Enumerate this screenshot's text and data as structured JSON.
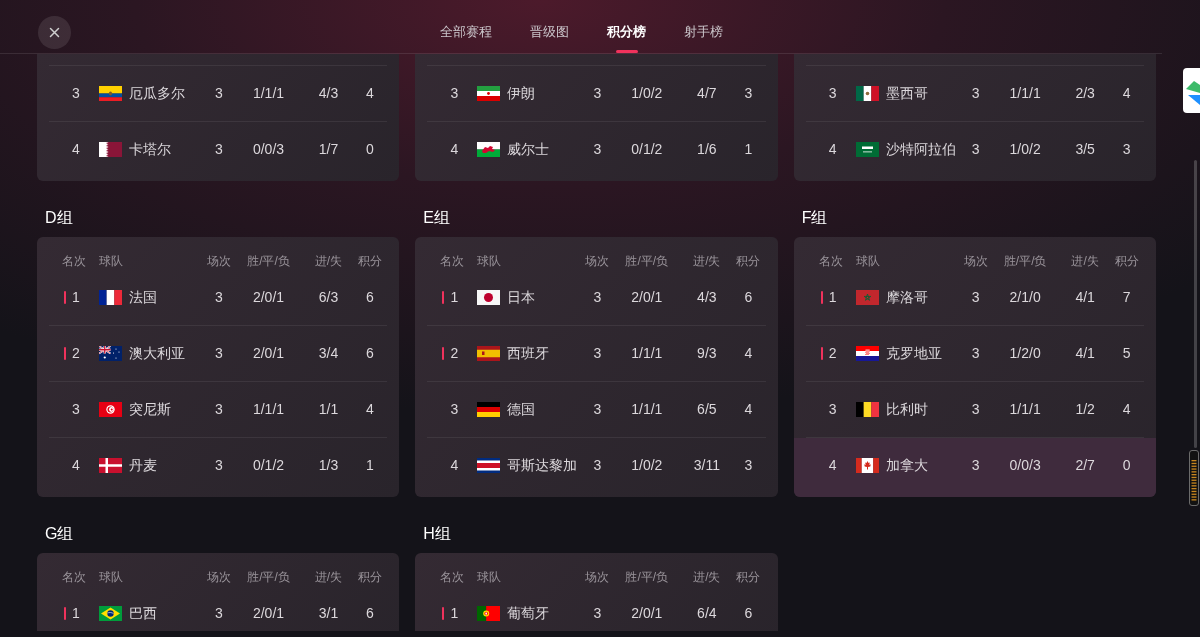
{
  "tabs": [
    {
      "label": "全部赛程",
      "selected": false
    },
    {
      "label": "晋级图",
      "selected": false
    },
    {
      "label": "积分榜",
      "selected": true
    },
    {
      "label": "射手榜",
      "selected": false
    }
  ],
  "groups": [
    {
      "rows": [
        {
          "rank": "3",
          "flag": {
            "kind": "ec"
          },
          "team": "厄瓜多尔",
          "played": "3",
          "win_draw_loss": "1/1/1",
          "goals": "4/3",
          "points": "4",
          "qualified": false,
          "highlighted": false
        },
        {
          "rank": "4",
          "flag": {
            "kind": "qa"
          },
          "team": "卡塔尔",
          "played": "3",
          "win_draw_loss": "0/0/3",
          "goals": "1/7",
          "points": "0",
          "qualified": false,
          "highlighted": false
        }
      ]
    },
    {
      "rows": [
        {
          "rank": "3",
          "flag": {
            "kind": "ir"
          },
          "team": "伊朗",
          "played": "3",
          "win_draw_loss": "1/0/2",
          "goals": "4/7",
          "points": "3",
          "qualified": false,
          "highlighted": false
        },
        {
          "rank": "4",
          "flag": {
            "kind": "wal"
          },
          "team": "威尔士",
          "played": "3",
          "win_draw_loss": "0/1/2",
          "goals": "1/6",
          "points": "1",
          "qualified": false,
          "highlighted": false
        }
      ]
    },
    {
      "rows": [
        {
          "rank": "3",
          "flag": {
            "kind": "mx"
          },
          "team": "墨西哥",
          "played": "3",
          "win_draw_loss": "1/1/1",
          "goals": "2/3",
          "points": "4",
          "qualified": false,
          "highlighted": false
        },
        {
          "rank": "4",
          "flag": {
            "kind": "sa"
          },
          "team": "沙特阿拉伯",
          "played": "3",
          "win_draw_loss": "1/0/2",
          "goals": "3/5",
          "points": "3",
          "qualified": false,
          "highlighted": false
        }
      ]
    },
    {
      "title": "D组",
      "columns": [
        "名次",
        "球队",
        "场次",
        "胜/平/负",
        "进/失",
        "积分"
      ],
      "rows": [
        {
          "rank": "1",
          "flag": {
            "kind": "fr"
          },
          "team": "法国",
          "played": "3",
          "win_draw_loss": "2/0/1",
          "goals": "6/3",
          "points": "6",
          "qualified": true,
          "highlighted": false
        },
        {
          "rank": "2",
          "flag": {
            "kind": "au"
          },
          "team": "澳大利亚",
          "played": "3",
          "win_draw_loss": "2/0/1",
          "goals": "3/4",
          "points": "6",
          "qualified": true,
          "highlighted": false
        },
        {
          "rank": "3",
          "flag": {
            "kind": "tn"
          },
          "team": "突尼斯",
          "played": "3",
          "win_draw_loss": "1/1/1",
          "goals": "1/1",
          "points": "4",
          "qualified": false,
          "highlighted": false
        },
        {
          "rank": "4",
          "flag": {
            "kind": "dk"
          },
          "team": "丹麦",
          "played": "3",
          "win_draw_loss": "0/1/2",
          "goals": "1/3",
          "points": "1",
          "qualified": false,
          "highlighted": false
        }
      ]
    },
    {
      "title": "E组",
      "columns": [
        "名次",
        "球队",
        "场次",
        "胜/平/负",
        "进/失",
        "积分"
      ],
      "rows": [
        {
          "rank": "1",
          "flag": {
            "kind": "jp"
          },
          "team": "日本",
          "played": "3",
          "win_draw_loss": "2/0/1",
          "goals": "4/3",
          "points": "6",
          "qualified": true,
          "highlighted": false
        },
        {
          "rank": "2",
          "flag": {
            "kind": "es"
          },
          "team": "西班牙",
          "played": "3",
          "win_draw_loss": "1/1/1",
          "goals": "9/3",
          "points": "4",
          "qualified": true,
          "highlighted": false
        },
        {
          "rank": "3",
          "flag": {
            "kind": "de"
          },
          "team": "德国",
          "played": "3",
          "win_draw_loss": "1/1/1",
          "goals": "6/5",
          "points": "4",
          "qualified": false,
          "highlighted": false
        },
        {
          "rank": "4",
          "flag": {
            "kind": "cr"
          },
          "team": "哥斯达黎加",
          "played": "3",
          "win_draw_loss": "1/0/2",
          "goals": "3/11",
          "points": "3",
          "qualified": false,
          "highlighted": false
        }
      ]
    },
    {
      "title": "F组",
      "columns": [
        "名次",
        "球队",
        "场次",
        "胜/平/负",
        "进/失",
        "积分"
      ],
      "rows": [
        {
          "rank": "1",
          "flag": {
            "kind": "ma"
          },
          "team": "摩洛哥",
          "played": "3",
          "win_draw_loss": "2/1/0",
          "goals": "4/1",
          "points": "7",
          "qualified": true,
          "highlighted": false
        },
        {
          "rank": "2",
          "flag": {
            "kind": "hr"
          },
          "team": "克罗地亚",
          "played": "3",
          "win_draw_loss": "1/2/0",
          "goals": "4/1",
          "points": "5",
          "qualified": true,
          "highlighted": false
        },
        {
          "rank": "3",
          "flag": {
            "kind": "be"
          },
          "team": "比利时",
          "played": "3",
          "win_draw_loss": "1/1/1",
          "goals": "1/2",
          "points": "4",
          "qualified": false,
          "highlighted": false
        },
        {
          "rank": "4",
          "flag": {
            "kind": "ca"
          },
          "team": "加拿大",
          "played": "3",
          "win_draw_loss": "0/0/3",
          "goals": "2/7",
          "points": "0",
          "qualified": false,
          "highlighted": true
        }
      ]
    },
    {
      "title": "G组",
      "columns": [
        "名次",
        "球队",
        "场次",
        "胜/平/负",
        "进/失",
        "积分"
      ],
      "rows": [
        {
          "rank": "1",
          "flag": {
            "kind": "br"
          },
          "team": "巴西",
          "played": "3",
          "win_draw_loss": "2/0/1",
          "goals": "3/1",
          "points": "6",
          "qualified": true,
          "highlighted": false
        }
      ]
    },
    {
      "title": "H组",
      "columns": [
        "名次",
        "球队",
        "场次",
        "胜/平/负",
        "进/失",
        "积分"
      ],
      "rows": [
        {
          "rank": "1",
          "flag": {
            "kind": "pt"
          },
          "team": "葡萄牙",
          "played": "3",
          "win_draw_loss": "2/0/1",
          "goals": "6/4",
          "points": "6",
          "qualified": true,
          "highlighted": false
        }
      ]
    }
  ]
}
